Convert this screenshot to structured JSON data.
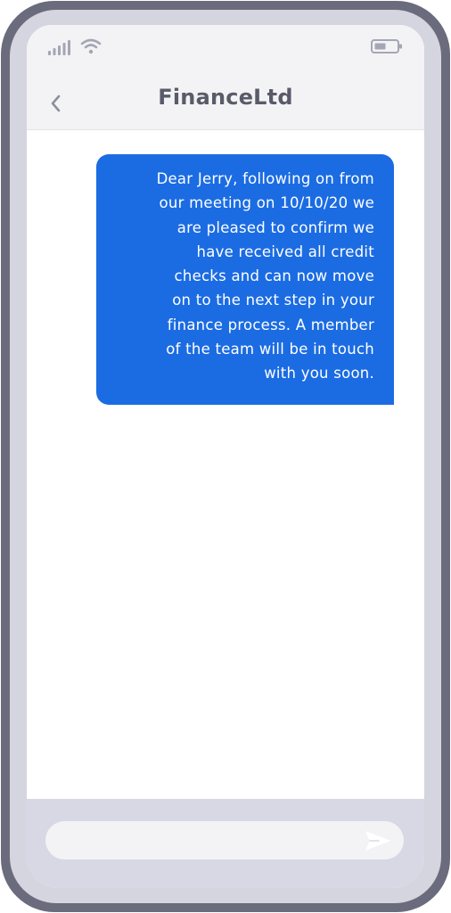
{
  "status_bar": {
    "icons": [
      "signal-icon",
      "wifi-icon",
      "battery-icon"
    ]
  },
  "header": {
    "title": "FinanceLtd",
    "back_icon": "chevron-left-icon"
  },
  "messages": [
    {
      "direction": "outgoing",
      "text": "Dear Jerry, following on from\nour meeting on 10/10/20 we\nare pleased to confirm we\nhave received all credit\nchecks and can now move\non to the next step in your\nfinance process. A member\nof the team will be in touch\nwith you soon."
    }
  ],
  "composer": {
    "placeholder": "",
    "value": "",
    "send_icon": "send-icon"
  },
  "colors": {
    "bubble": "#1b6ce3",
    "frame": "#6a6b7c",
    "header_bg": "#f3f3f6",
    "composer_bg": "#d7d8e3",
    "icon_gray": "#a5a6b4"
  }
}
